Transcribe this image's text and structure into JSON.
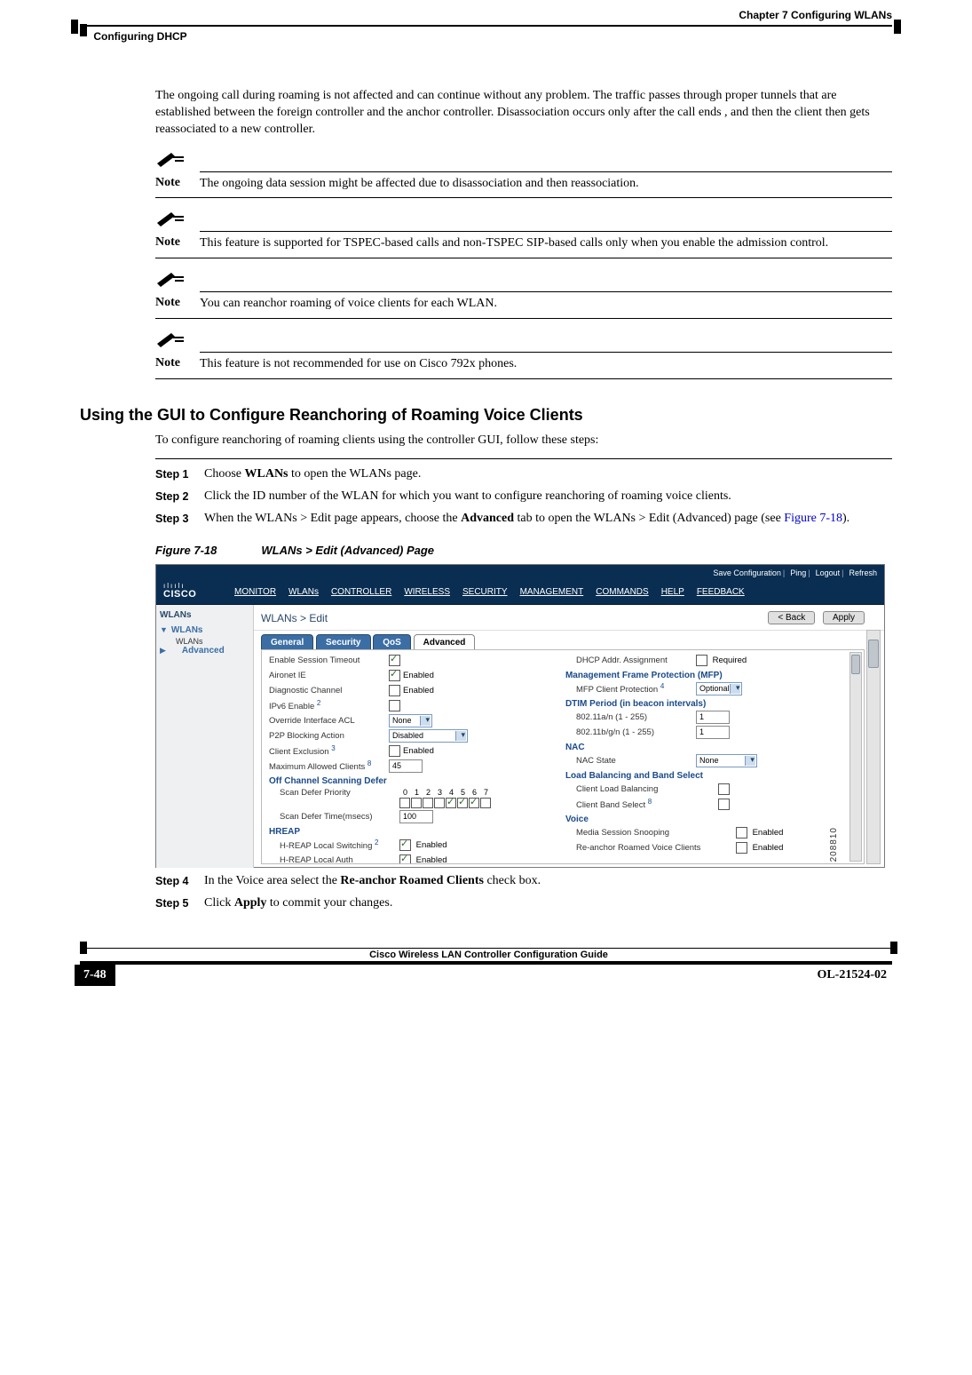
{
  "header": {
    "chapter": "Chapter 7      Configuring WLANs",
    "section": "Configuring DHCP"
  },
  "paragraphs": {
    "intro": "The ongoing call during roaming is not affected and can continue without any problem. The traffic passes through proper tunnels that are established between the foreign controller and the anchor controller. Disassociation occurs only after the call ends , and then the client then gets reassociated to a new controller."
  },
  "notes": [
    {
      "label": "Note",
      "text": "The ongoing data session might be affected due to disassociation and then reassociation."
    },
    {
      "label": "Note",
      "text": "This feature is supported for TSPEC-based calls and non-TSPEC SIP-based calls only when you enable the admission control."
    },
    {
      "label": "Note",
      "text": "You can reanchor roaming of voice clients for each WLAN."
    },
    {
      "label": "Note",
      "text": "This feature is not recommended for use on Cisco 792x phones."
    }
  ],
  "section_title": "Using the GUI to Configure Reanchoring of Roaming Voice Clients",
  "section_intro": "To configure reanchoring of roaming clients using the controller GUI, follow these steps:",
  "steps": [
    {
      "label": "Step 1",
      "prefix": "Choose ",
      "bold1": "WLANs",
      "suffix": " to open the WLANs page."
    },
    {
      "label": "Step 2",
      "text": "Click the ID number of the WLAN for which you want to configure reanchoring of roaming voice clients."
    },
    {
      "label": "Step 3",
      "prefix": "When the WLANs > Edit page appears, choose the ",
      "bold1": "Advanced",
      "mid": " tab to open the WLANs > Edit (Advanced) page (see ",
      "figref": "Figure 7-18",
      "suffix2": ")."
    },
    {
      "label": "Step 4",
      "prefix": "In the Voice area select the ",
      "bold1": "Re-anchor Roamed Clients",
      "suffix": " check box."
    },
    {
      "label": "Step 5",
      "prefix": "Click ",
      "bold1": "Apply",
      "suffix": " to commit your changes."
    }
  ],
  "figure": {
    "fignum": "Figure 7-18",
    "title": "WLANs > Edit (Advanced) Page"
  },
  "screenshot": {
    "toplinks": [
      "Save Configuration",
      "Ping",
      "Logout",
      "Refresh"
    ],
    "logo": {
      "dots": "ılıılı",
      "name": "CISCO"
    },
    "menu": [
      "MONITOR",
      "WLANs",
      "CONTROLLER",
      "WIRELESS",
      "SECURITY",
      "MANAGEMENT",
      "COMMANDS",
      "HELP",
      "FEEDBACK"
    ],
    "sidebar": {
      "title": "WLANs",
      "root": "WLANs",
      "child": "WLANs",
      "advanced": "Advanced"
    },
    "main": {
      "title": "WLANs > Edit",
      "buttons": {
        "back": "< Back",
        "apply": "Apply"
      },
      "tabs": [
        "General",
        "Security",
        "QoS",
        "Advanced"
      ],
      "left": {
        "row_cut": "Enable Session Timeout",
        "aironet": "Aironet IE",
        "diag": "Diagnostic Channel",
        "ipv6": "IPv6 Enable",
        "override": "Override Interface ACL",
        "override_val": "None",
        "p2p": "P2P Blocking Action",
        "p2p_val": "Disabled",
        "clientex": "Client Exclusion",
        "maxclients": "Maximum Allowed Clients",
        "maxclients_val": "45",
        "section_off": "Off Channel Scanning Defer",
        "scanprio": "Scan Defer Priority",
        "scantime": "Scan Defer Time(msecs)",
        "scantime_val": "100",
        "section_hreap": "HREAP",
        "hreap_local": "H-REAP Local Switching",
        "hreap_auth": "H-REAP Local Auth",
        "enabled_label": "Enabled",
        "priority_nums": [
          "0",
          "1",
          "2",
          "3",
          "4",
          "5",
          "6",
          "7"
        ]
      },
      "right": {
        "dhcp": "DHCP Addr. Assignment",
        "dhcp_req": "Required",
        "section_mfp": "Management Frame Protection (MFP)",
        "mfp": "MFP Client Protection",
        "mfp_val": "Optional",
        "section_dtim": "DTIM Period (in beacon intervals)",
        "dtim_a": "802.11a/n (1 - 255)",
        "dtim_a_val": "1",
        "dtim_b": "802.11b/g/n (1 - 255)",
        "dtim_b_val": "1",
        "section_nac": "NAC",
        "nac_state": "NAC State",
        "nac_val": "None",
        "section_lb": "Load Balancing and Band Select",
        "lb_client": "Client Load Balancing",
        "lb_band": "Client Band Select",
        "section_voice": "Voice",
        "voice_media": "Media Session Snooping",
        "voice_reanchor": "Re-anchor Roamed Voice Clients",
        "enabled_label": "Enabled"
      }
    },
    "sidenum": "208810"
  },
  "footer": {
    "title": "Cisco Wireless LAN Controller Configuration Guide",
    "pagenum": "7-48",
    "docid": "OL-21524-02"
  }
}
